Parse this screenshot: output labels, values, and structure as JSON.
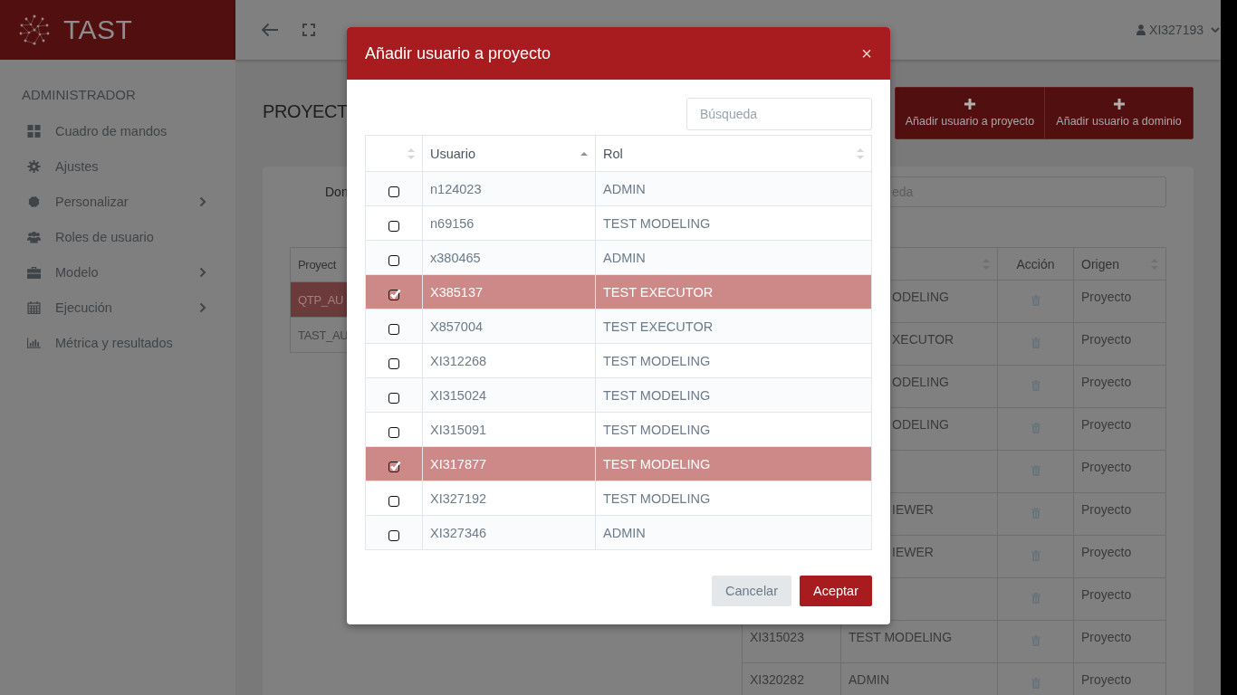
{
  "app": {
    "name": "TAST"
  },
  "topbar": {
    "user": "XI327193"
  },
  "sidebar": {
    "section": "ADMINISTRADOR",
    "items": [
      {
        "label": "Cuadro de mandos",
        "has_submenu": false
      },
      {
        "label": "Ajustes",
        "has_submenu": false
      },
      {
        "label": "Personalizar",
        "has_submenu": true
      },
      {
        "label": "Roles de usuario",
        "has_submenu": false
      },
      {
        "label": "Modelo",
        "has_submenu": true
      },
      {
        "label": "Ejecución",
        "has_submenu": true
      },
      {
        "label": "Métrica y resultados",
        "has_submenu": false
      }
    ]
  },
  "page": {
    "title": "PROYECT",
    "actions": [
      {
        "label": "Añadir usuario a proyecto"
      },
      {
        "label": "Añadir usuario a dominio"
      }
    ],
    "filter_label": "Don",
    "search": {
      "placeholder": "eda"
    },
    "projects_table": {
      "column": "Proyect",
      "rows": [
        {
          "name": "QTP_AU",
          "selected": true
        },
        {
          "name": "TAST_AU",
          "selected": false
        }
      ]
    },
    "users_table": {
      "columns": [
        "Acción",
        "Origen"
      ],
      "rows": [
        {
          "role": "ODELING",
          "origin": "Proyecto"
        },
        {
          "role": "XECUTOR",
          "origin": "Proyecto"
        },
        {
          "role": "ODELING",
          "origin": "Proyecto"
        },
        {
          "role": "ODELING",
          "origin": "Proyecto"
        },
        {
          "origin": "Proyecto"
        },
        {
          "role": "IEWER",
          "origin": "Proyecto"
        },
        {
          "role": "IEWER",
          "origin": "Proyecto"
        },
        {
          "origin": "Proyecto"
        },
        {
          "user": "XI315023",
          "role": "TEST MODELING",
          "origin": "Proyecto"
        },
        {
          "user": "XI320282",
          "role": "ADMIN",
          "origin": "Proyecto"
        }
      ]
    }
  },
  "dialog": {
    "title": "Añadir usuario a proyecto",
    "close": "×",
    "search": {
      "placeholder": "Búsqueda"
    },
    "columns": [
      {
        "label": "Usuario",
        "sorted": true
      },
      {
        "label": "Rol",
        "sorted": false
      }
    ],
    "rows": [
      {
        "user": "n124023",
        "role": "ADMIN",
        "selected": false
      },
      {
        "user": "n69156",
        "role": "TEST MODELING",
        "selected": false
      },
      {
        "user": "x380465",
        "role": "ADMIN",
        "selected": false
      },
      {
        "user": "X385137",
        "role": "TEST EXECUTOR",
        "selected": true
      },
      {
        "user": "X857004",
        "role": "TEST EXECUTOR",
        "selected": false
      },
      {
        "user": "XI312268",
        "role": "TEST MODELING",
        "selected": false
      },
      {
        "user": "XI315024",
        "role": "TEST MODELING",
        "selected": false
      },
      {
        "user": "XI315091",
        "role": "TEST MODELING",
        "selected": false
      },
      {
        "user": "XI317877",
        "role": "TEST MODELING",
        "selected": true
      },
      {
        "user": "XI327192",
        "role": "TEST MODELING",
        "selected": false
      },
      {
        "user": "XI327346",
        "role": "ADMIN",
        "selected": false
      }
    ],
    "buttons": [
      {
        "label": "Cancelar",
        "kind": "secondary"
      },
      {
        "label": "Aceptar",
        "kind": "primary"
      }
    ]
  }
}
